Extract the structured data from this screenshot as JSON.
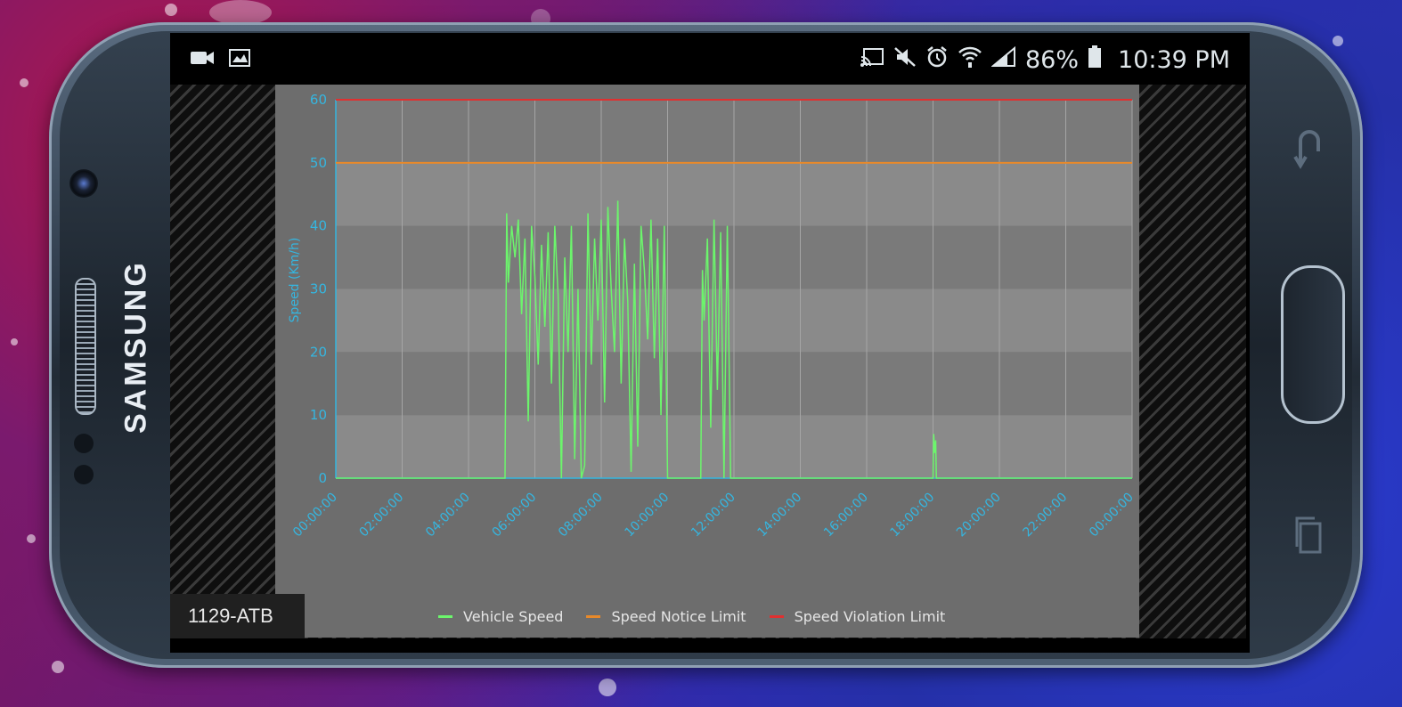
{
  "device": {
    "brand": "SAMSUNG"
  },
  "status_bar": {
    "left_icons": [
      "video-camera-icon",
      "gallery-icon"
    ],
    "right_icons": [
      "cast-icon",
      "mute-icon",
      "alarm-icon",
      "wifi-icon",
      "signal-icon",
      "battery-icon"
    ],
    "battery": "86%",
    "time": "10:39 PM"
  },
  "vehicle": {
    "id": "1129-ATB"
  },
  "legend": {
    "vehicle_speed": "Vehicle Speed",
    "notice_limit": "Speed Notice Limit",
    "violation_limit": "Speed Violation Limit"
  },
  "colors": {
    "vehicle_speed": "#6cf56c",
    "notice_limit": "#e8892a",
    "violation_limit": "#e03030",
    "axis": "#35b6e0"
  },
  "chart_data": {
    "type": "line",
    "ylabel": "Speed (Km/h)",
    "ylim": [
      0,
      60
    ],
    "yticks": [
      "0",
      "10",
      "20",
      "30",
      "40",
      "50",
      "60"
    ],
    "xticks": [
      "00:00:00",
      "02:00:00",
      "04:00:00",
      "06:00:00",
      "08:00:00",
      "10:00:00",
      "12:00:00",
      "14:00:00",
      "16:00:00",
      "18:00:00",
      "20:00:00",
      "22:00:00",
      "00:00:00"
    ],
    "grid": true,
    "series": [
      {
        "name": "Speed Violation Limit",
        "x": [
          0,
          24
        ],
        "values": [
          60,
          60
        ]
      },
      {
        "name": "Speed Notice Limit",
        "x": [
          0,
          24
        ],
        "values": [
          50,
          50
        ]
      },
      {
        "name": "Vehicle Speed",
        "x": [
          0,
          5.1,
          5.15,
          5.2,
          5.3,
          5.4,
          5.5,
          5.6,
          5.7,
          5.8,
          5.9,
          6.0,
          6.1,
          6.2,
          6.3,
          6.4,
          6.5,
          6.6,
          6.7,
          6.8,
          6.9,
          7.0,
          7.1,
          7.2,
          7.3,
          7.4,
          7.5,
          7.6,
          7.7,
          7.8,
          7.9,
          8.0,
          8.1,
          8.2,
          8.3,
          8.4,
          8.5,
          8.6,
          8.7,
          8.8,
          8.9,
          9.0,
          9.1,
          9.2,
          9.3,
          9.4,
          9.5,
          9.6,
          9.7,
          9.8,
          9.9,
          10.0,
          10.1,
          10.2,
          10.3,
          10.4,
          10.5,
          10.6,
          10.7,
          10.8,
          10.9,
          11.0,
          11.05,
          11.1,
          11.2,
          11.3,
          11.4,
          11.5,
          11.6,
          11.7,
          11.8,
          11.9,
          12.0,
          12.1,
          12.2,
          12.3,
          12.4,
          12.5,
          12.6,
          12.65,
          12.7,
          18.0,
          18.02,
          18.05,
          18.08,
          18.1,
          24
        ],
        "values": [
          0,
          0,
          42,
          31,
          40,
          35,
          41,
          26,
          38,
          9,
          40,
          32,
          18,
          37,
          24,
          39,
          15,
          40,
          29,
          0,
          35,
          20,
          40,
          3,
          30,
          0,
          2,
          42,
          18,
          38,
          25,
          41,
          12,
          43,
          30,
          20,
          44,
          15,
          38,
          28,
          1,
          34,
          5,
          40,
          33,
          22,
          41,
          19,
          38,
          10,
          40,
          0,
          0,
          0,
          0,
          0,
          0,
          0,
          0,
          0,
          0,
          0,
          33,
          25,
          38,
          8,
          41,
          14,
          39,
          0,
          40,
          0,
          0,
          0,
          0,
          0,
          0,
          0,
          0,
          0,
          0,
          0,
          7,
          4,
          6,
          0,
          0
        ]
      }
    ]
  }
}
